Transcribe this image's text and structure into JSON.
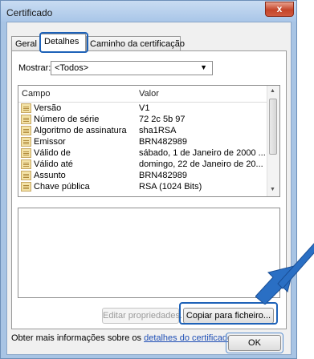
{
  "window": {
    "title": "Certificado",
    "close_label": "x"
  },
  "tabs": [
    {
      "label": "Geral"
    },
    {
      "label": "Detalhes"
    },
    {
      "label": "Caminho da certificação"
    }
  ],
  "show": {
    "label": "Mostrar:",
    "value": "<Todos>"
  },
  "list": {
    "columns": [
      "Campo",
      "Valor"
    ],
    "rows": [
      {
        "field": "Versão",
        "value": "V1"
      },
      {
        "field": "Número de série",
        "value": "72 2c 5b 97"
      },
      {
        "field": "Algoritmo de assinatura",
        "value": "sha1RSA"
      },
      {
        "field": "Emissor",
        "value": "BRN482989"
      },
      {
        "field": "Válido de",
        "value": "sábado, 1 de Janeiro de 2000 ..."
      },
      {
        "field": "Válido até",
        "value": "domingo, 22 de Janeiro de 20..."
      },
      {
        "field": "Assunto",
        "value": "BRN482989"
      },
      {
        "field": "Chave pública",
        "value": "RSA (1024 Bits)"
      }
    ]
  },
  "buttons": {
    "edit_properties": "Editar propriedades...",
    "copy_to_file": "Copiar para ficheiro...",
    "ok": "OK"
  },
  "info": {
    "text": "Obter mais informações sobre os ",
    "link": "detalhes do certificado"
  },
  "colors": {
    "highlight": "#1e62b8",
    "arrow": "#2a6fc4"
  }
}
